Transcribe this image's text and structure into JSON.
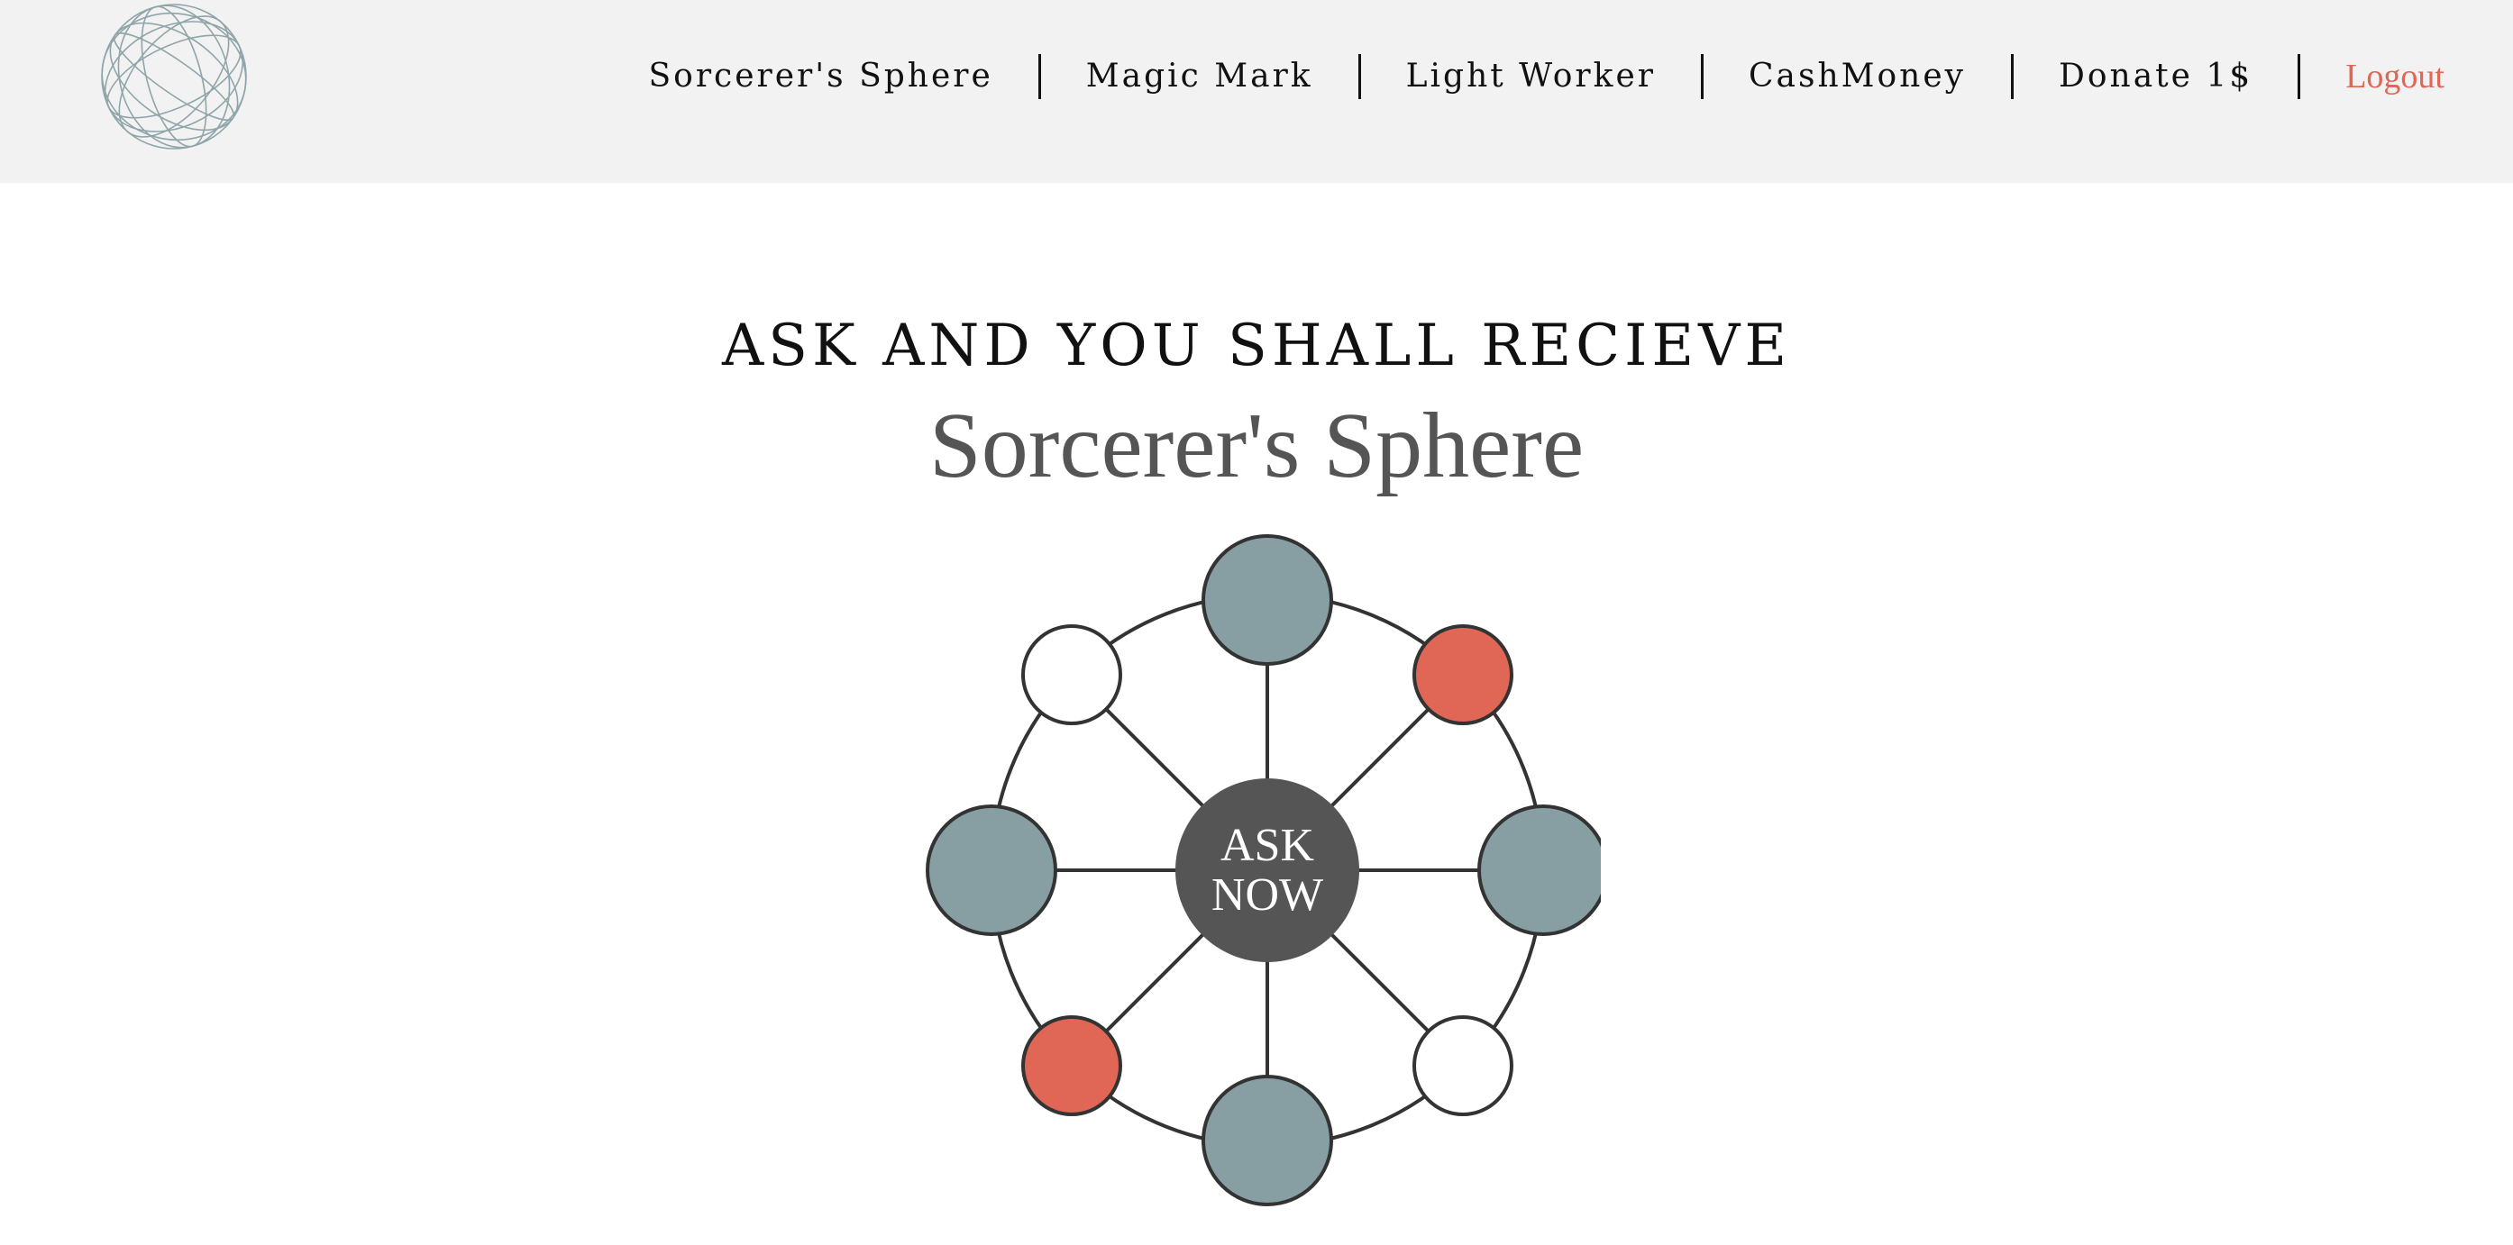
{
  "header": {
    "logo_icon": "wireframe-globe-icon",
    "nav": {
      "items": [
        {
          "label": "Sorcerer's Sphere"
        },
        {
          "label": "Magic Mark"
        },
        {
          "label": "Light Worker"
        },
        {
          "label": "CashMoney"
        },
        {
          "label": "Donate 1$"
        }
      ],
      "logout_label": "Logout"
    }
  },
  "main": {
    "subtitle": "ASK AND YOU SHALL RECIEVE",
    "title": "Sorcerer's Sphere",
    "ask_button": {
      "line1": "ASK",
      "line2": "NOW"
    }
  },
  "colors": {
    "header_bg": "#f2f2f2",
    "accent_red": "#e06656",
    "node_gray_blue": "#879fa3",
    "center_dark": "#555555",
    "title_gray": "#555555",
    "stroke": "#333333"
  }
}
